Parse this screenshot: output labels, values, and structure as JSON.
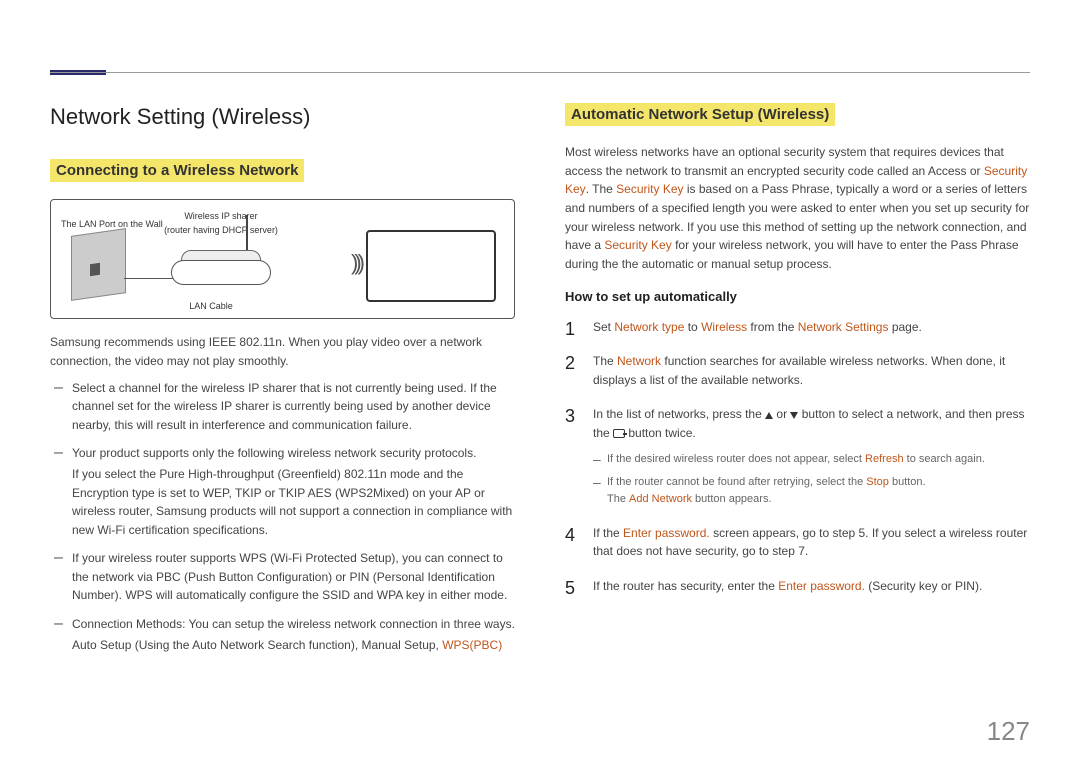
{
  "page_number": "127",
  "left": {
    "h1": "Network Setting (Wireless)",
    "section": "Connecting to a Wireless Network",
    "diagram": {
      "sharer_label": "Wireless IP sharer",
      "sharer_sub": "(router having DHCP server)",
      "wall_label": "The LAN Port on the Wall",
      "cable_label": "LAN Cable"
    },
    "intro": "Samsung recommends using IEEE 802.11n. When you play video over a network connection, the video may not play smoothly.",
    "bullets": [
      {
        "main": "Select a channel for the wireless IP sharer that is not currently being used. If the channel set for the wireless IP sharer is currently being used by another device nearby, this will result in interference and communication failure."
      },
      {
        "main": "Your product supports only the following wireless network security protocols.",
        "sub": "If you select the Pure High-throughput (Greenfield) 802.11n mode and the Encryption type is set to WEP, TKIP or TKIP AES (WPS2Mixed) on your AP or wireless router, Samsung products will not support a connection in compliance with new Wi-Fi certification specifications."
      },
      {
        "main": "If your wireless router supports WPS (Wi-Fi Protected Setup), you can connect to the network via PBC (Push Button Configuration) or PIN (Personal Identification Number). WPS will automatically configure the SSID and WPA key in either mode."
      },
      {
        "main": "Connection Methods: You can setup the wireless network connection in three ways.",
        "sub_pre": "Auto Setup (Using the Auto Network Search function), Manual Setup, ",
        "sub_hl": "WPS(PBC)"
      }
    ]
  },
  "right": {
    "section": "Automatic Network Setup (Wireless)",
    "para_pre": "Most wireless networks have an optional security system that requires devices that access the network to transmit an encrypted security code called an Access or ",
    "para_key1": "Security Key",
    "para_mid1": ". The ",
    "para_key2": "Security Key",
    "para_mid2": " is based on a Pass Phrase, typically a word or a series of letters and numbers of a specified length you were asked to enter when you set up security for your wireless network. If you use this method of setting up the network connection, and have a ",
    "para_key3": "Security Key",
    "para_post": " for your wireless network, you will have to enter the Pass Phrase during the the automatic or manual setup process.",
    "subhead": "How to set up automatically",
    "steps": {
      "s1_pre": "Set ",
      "s1_hl1": "Network type",
      "s1_mid1": " to ",
      "s1_hl2": "Wireless",
      "s1_mid2": " from the ",
      "s1_hl3": "Network Settings",
      "s1_post": " page.",
      "s2_pre": "The ",
      "s2_hl1": "Network",
      "s2_post": " function searches for available wireless networks. When done, it displays a list of the available networks.",
      "s3_pre": "In the list of networks, press the ",
      "s3_mid": " or ",
      "s3_mid2": " button to select a network, and then press the ",
      "s3_post": " button twice.",
      "s3_sub1_pre": "If the desired wireless router does not appear, select ",
      "s3_sub1_hl": "Refresh",
      "s3_sub1_post": " to search again.",
      "s3_sub2_pre": "If the router cannot be found after retrying, select the ",
      "s3_sub2_hl": "Stop",
      "s3_sub2_post": " button.",
      "s3_sub3_pre": "The ",
      "s3_sub3_hl": "Add Network",
      "s3_sub3_post": " button appears.",
      "s4_pre": "If the ",
      "s4_hl": "Enter password.",
      "s4_post": " screen appears, go to step 5. If you select a wireless router that does not have security, go to step 7.",
      "s5_pre": "If the router has security, enter the ",
      "s5_hl": "Enter password.",
      "s5_post": " (Security key or PIN)."
    }
  }
}
